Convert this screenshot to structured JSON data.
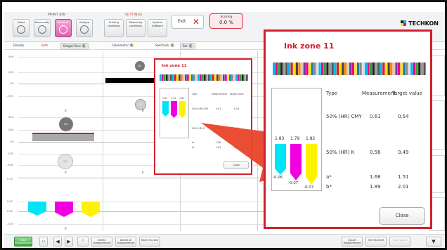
{
  "toolbar": {
    "print_job_group": "PRINT JOB",
    "settings_group": "SETTINGS",
    "buttons": [
      {
        "label": "Select",
        "icon": "select-icon"
      },
      {
        "label": "Make ready",
        "icon": "make-ready-icon"
      },
      {
        "label": "Measure",
        "icon": "measure-icon",
        "active": true
      },
      {
        "label": "Analyze",
        "icon": "analyze-icon"
      }
    ],
    "settings_buttons": [
      {
        "label": "Printing conditions"
      },
      {
        "label": "Measuring conditions"
      },
      {
        "label": "System/ Software"
      }
    ],
    "exit_label": "Exit",
    "scoring_label": "Scoring",
    "scoring_value": "0.0 %",
    "brand": "TECHKON"
  },
  "subtabs": [
    {
      "label": "Density"
    },
    {
      "label": "Both"
    },
    {
      "label": "DotgainTone"
    },
    {
      "label": "Colorimetric"
    },
    {
      "label": "SekCheck"
    },
    {
      "label": "Bar"
    }
  ],
  "grid": {
    "y_ticks_top": [
      "40%",
      "20%",
      "0%",
      "-20%"
    ],
    "y_ticks_mid": [
      "40%",
      "20%",
      "0%",
      "-20%",
      "-40%"
    ],
    "y_ticks_bottom": [
      "0.15",
      "0.03",
      "0.00",
      "-0.03"
    ],
    "col_values_1": [
      "0",
      "0",
      "0"
    ],
    "col_values_2": [
      "0",
      "0",
      "0",
      "0"
    ],
    "circle_labels": [
      "DC",
      "DC",
      "DC",
      "DC"
    ]
  },
  "popup_small": {
    "title": "Ink zone 11",
    "header_type": "Type",
    "header_measurement": "Measurement",
    "header_target": "Target value",
    "rows": [
      {
        "type": "50% (HR) CMY",
        "measurement": "0.61",
        "target": "0.54"
      },
      {
        "type": "50% (HR) K",
        "measurement": "0.56",
        "target": "0.49"
      },
      {
        "type": "a*",
        "measurement": "1.68",
        "target": "1.51"
      },
      {
        "type": "b*",
        "measurement": "1.89",
        "target": "2.01"
      }
    ],
    "close_label": "Close"
  },
  "popup_big": {
    "title": "Ink zone 11",
    "header_type": "Type",
    "header_measurement": "Measurement",
    "header_target": "Target value",
    "bar_top_values": [
      "1.83",
      "1.79",
      "1.82"
    ],
    "bar_bottom_values": [
      "-0.06",
      "-0.07",
      "-0.07"
    ],
    "rows": [
      {
        "type": "50% (HR) CMY",
        "measurement": "0.61",
        "target": "0.54"
      },
      {
        "type": "50% (HR) K",
        "measurement": "0.56",
        "target": "0.49"
      },
      {
        "type": "a*",
        "measurement": "1.68",
        "target": "1.51"
      },
      {
        "type": "b*",
        "measurement": "1.89",
        "target": "2.01"
      }
    ],
    "close_label": "Close"
  },
  "bottom_bar": {
    "start_label": "Start measurement",
    "delete_label": "Delete measurement",
    "delete_all_label": "Delete all measurement",
    "mark_zone_label": "Mark ink zone",
    "export_label": "Export measurement",
    "set_ok_label": "Set OK-Sheet",
    "to_ok_label": "To ok sheet",
    "counter_value": "11"
  },
  "colors": {
    "cyan": "#00e5f5",
    "magenta": "#f000e0",
    "yellow": "#fff200",
    "highlight_red": "#d0202e"
  }
}
